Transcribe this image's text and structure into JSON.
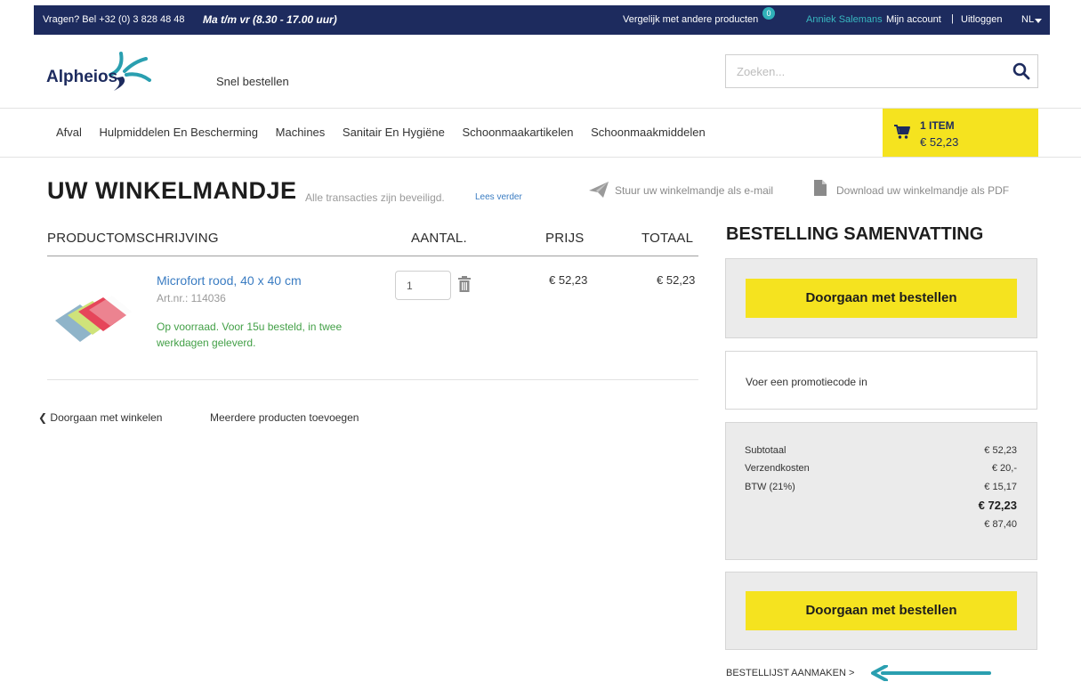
{
  "topbar": {
    "phone": "Vragen? Bel +32 (0) 3 828 48 48",
    "hours": "Ma t/m vr (8.30 - 17.00 uur)",
    "compare": "Vergelijk met andere producten",
    "compare_count": "0",
    "username": "Anniek Salemans",
    "account": "Mijn account",
    "separator": "|",
    "logout": "Uitloggen",
    "language": "NL"
  },
  "header": {
    "logo_text": "Alpheios",
    "quick_order": "Snel bestellen",
    "search_placeholder": "Zoeken..."
  },
  "nav": {
    "items": [
      "Afval",
      "Hulpmiddelen En Bescherming",
      "Machines",
      "Sanitair En Hygiëne",
      "Schoonmaakartikelen",
      "Schoonmaakmiddelen"
    ]
  },
  "cart": {
    "items": "1 ITEM",
    "total": "€ 52,23"
  },
  "page": {
    "title": "UW WINKELMANDJE",
    "secure": "Alle transacties zijn beveiligd.",
    "read_more": "Lees verder",
    "email": "Stuur uw winkelmandje als e-mail",
    "pdf": "Download uw winkelmandje als PDF"
  },
  "table": {
    "headers": {
      "product": "PRODUCTOMSCHRIJVING",
      "quantity": "AANTAL.",
      "price": "PRIJS",
      "total": "TOTAAL"
    },
    "rows": [
      {
        "name": "Microfort rood, 40 x 40 cm",
        "article": "Art.nr.: 114036",
        "stock": "Op voorraad. Voor 15u besteld, in twee werkdagen geleverd.",
        "quantity": "1",
        "price": "€ 52,23",
        "total": "€ 52,23"
      }
    ]
  },
  "links": {
    "continue_shopping": "Doorgaan met winkelen",
    "add_more": "Meerdere producten toevoegen"
  },
  "summary": {
    "title": "BESTELLING SAMENVATTING",
    "order_button": "Doorgaan met bestellen",
    "promo": "Voer een promotiecode in",
    "lines": [
      {
        "label": "Subtotaal",
        "value": "€ 52,23"
      },
      {
        "label": "Verzendkosten",
        "value": "€ 20,-"
      },
      {
        "label": "BTW (21%)",
        "value": "€ 15,17"
      }
    ],
    "total_excl": "€ 72,23",
    "total_incl": "€ 87,40",
    "order_list": "BESTELLIJST AANMAKEN >"
  },
  "colors": {
    "navy": "#1d2b5e",
    "yellow": "#f5e31f",
    "teal": "#2a9fb0",
    "link_blue": "#3a7cc2",
    "stock_green": "#43a047"
  }
}
